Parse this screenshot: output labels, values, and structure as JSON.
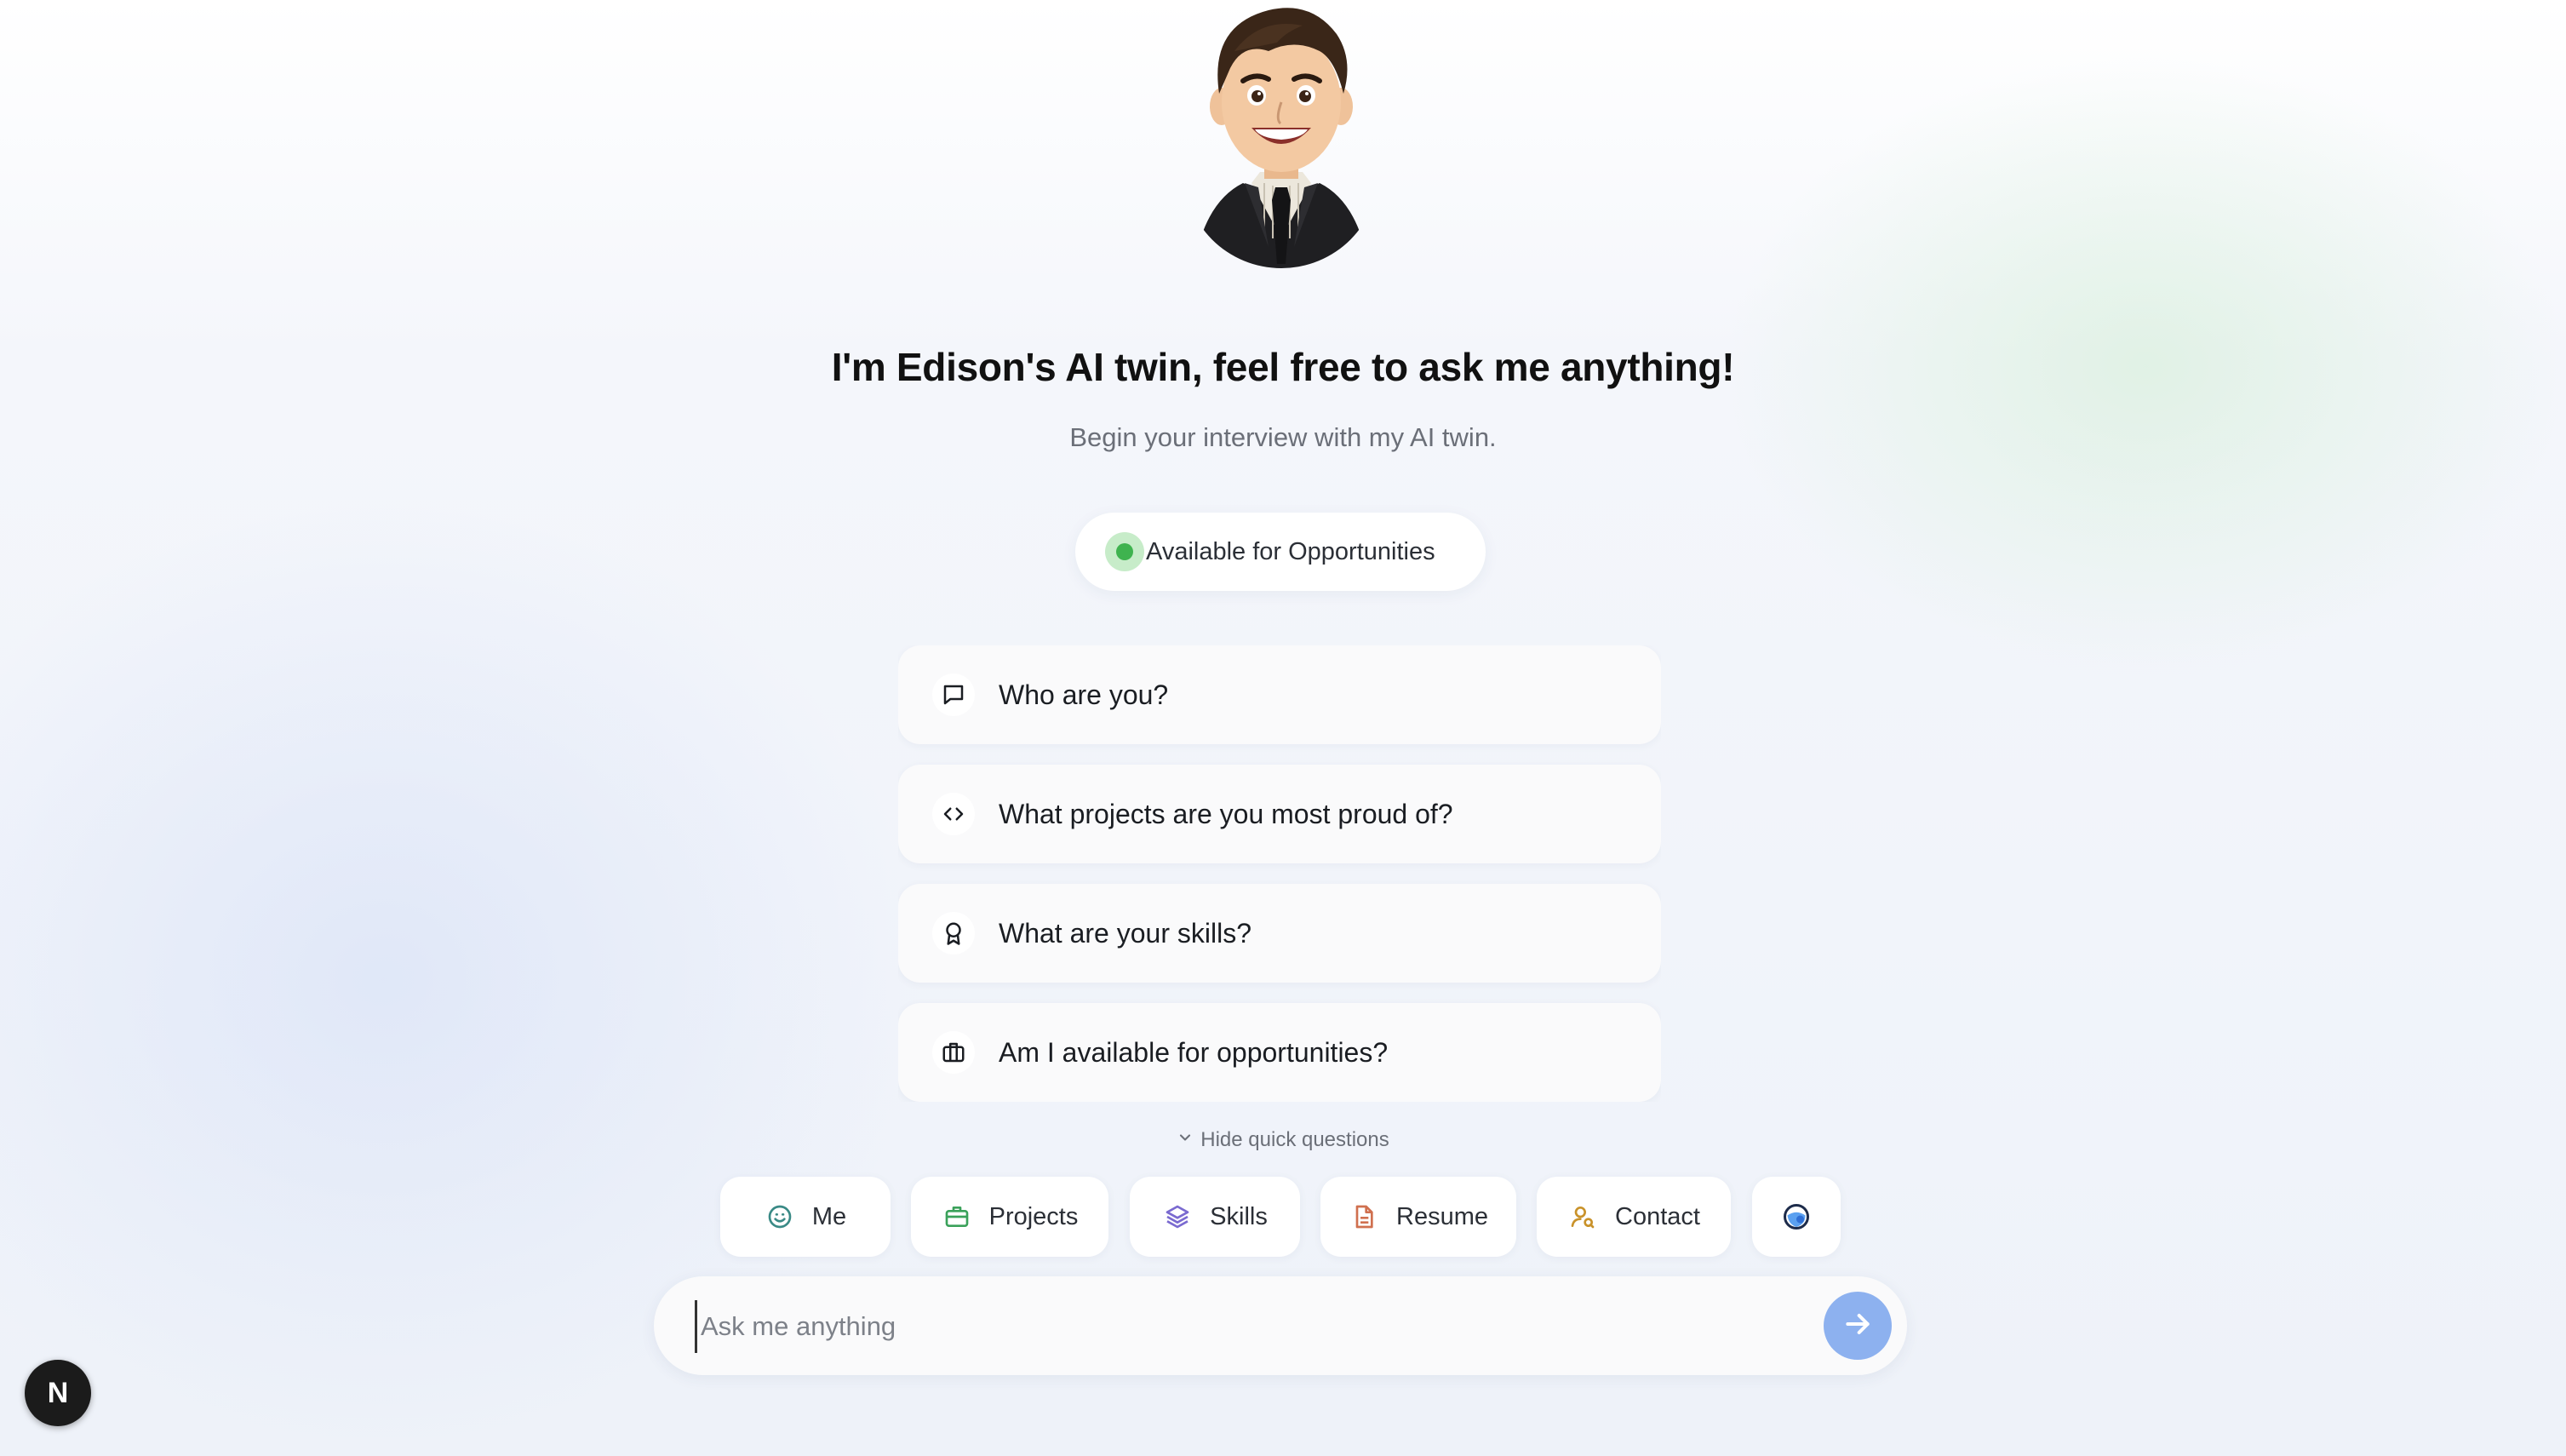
{
  "avatar": {
    "name": "avatar",
    "alt": "Edison cartoon avatar"
  },
  "hero": {
    "headline": "I'm Edison's AI twin, feel free to ask me anything!",
    "subheadline": "Begin your interview with my AI twin."
  },
  "status": {
    "label": "Available for Opportunities",
    "color": "#3fb34f"
  },
  "quick_questions": [
    {
      "icon": "message-square-icon",
      "text": "Who are you?"
    },
    {
      "icon": "code-icon",
      "text": "What projects are you most proud of?"
    },
    {
      "icon": "award-icon",
      "text": "What are your skills?"
    },
    {
      "icon": "briefcase-icon",
      "text": "Am I available for opportunities?"
    }
  ],
  "toggle": {
    "label": "Hide quick questions",
    "icon": "chevron-down-icon"
  },
  "chips": [
    {
      "label": "Me",
      "icon": "smile-icon",
      "color": "#3a8a86"
    },
    {
      "label": "Projects",
      "icon": "briefcase-icon",
      "color": "#3aa15a"
    },
    {
      "label": "Skills",
      "icon": "layers-icon",
      "color": "#7a6ad0"
    },
    {
      "label": "Resume",
      "icon": "file-text-icon",
      "color": "#d0704f"
    },
    {
      "label": "Contact",
      "icon": "user-search-icon",
      "color": "#c9922a"
    },
    {
      "label": "",
      "icon": "globe-icon",
      "color": "#2f6fd6"
    }
  ],
  "composer": {
    "placeholder": "Ask me anything",
    "send_icon": "arrow-right-icon",
    "send_color": "#8db1ef"
  },
  "dev_badge": {
    "label": "N"
  }
}
